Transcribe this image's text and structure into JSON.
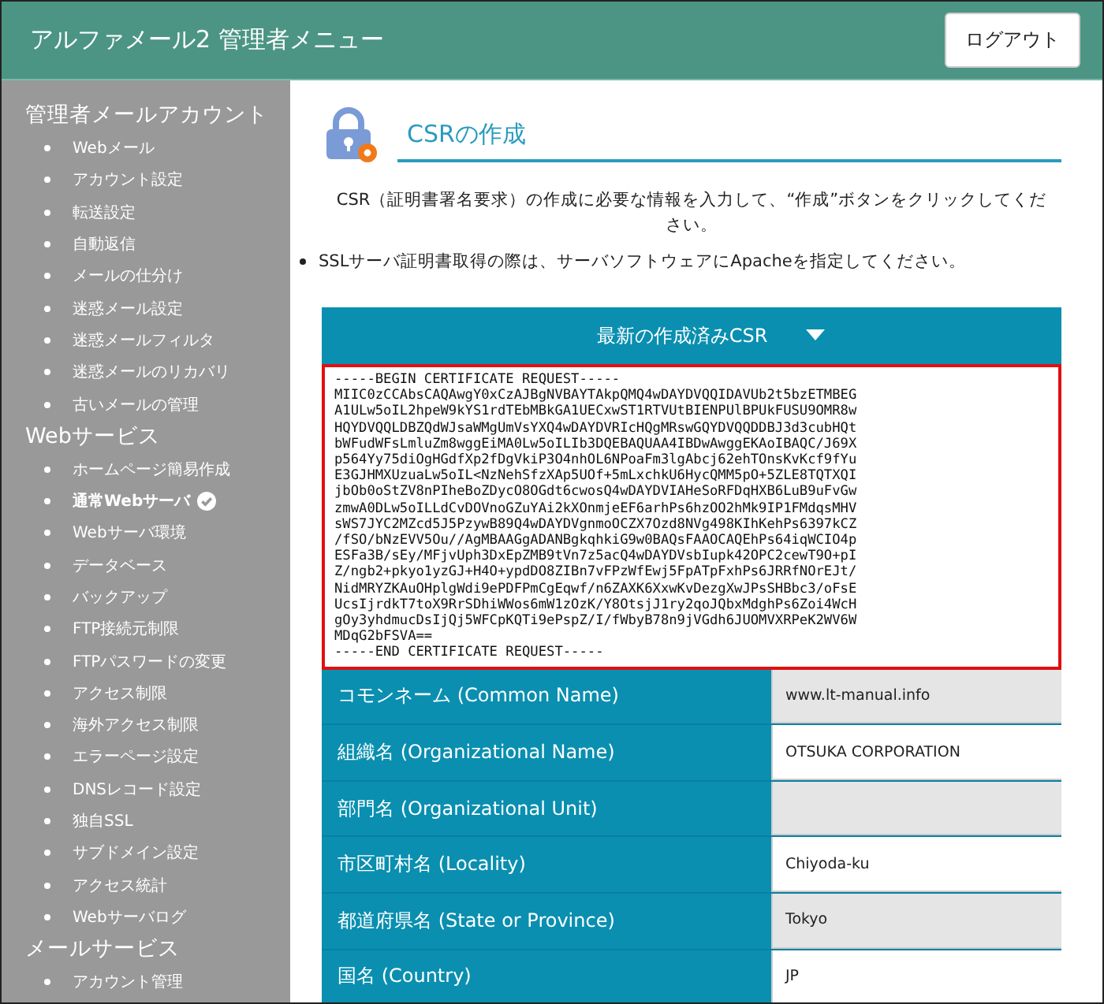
{
  "header": {
    "title": "アルファメール2 管理者メニュー",
    "logout_button": "ログアウト"
  },
  "sidebar": {
    "sections": [
      {
        "title": "管理者メールアカウント",
        "items": [
          {
            "label": "Webメール",
            "selected": false
          },
          {
            "label": "アカウント設定",
            "selected": false
          },
          {
            "label": "転送設定",
            "selected": false
          },
          {
            "label": "自動返信",
            "selected": false
          },
          {
            "label": "メールの仕分け",
            "selected": false
          },
          {
            "label": "迷惑メール設定",
            "selected": false
          },
          {
            "label": "迷惑メールフィルタ",
            "selected": false
          },
          {
            "label": "迷惑メールのリカバリ",
            "selected": false
          },
          {
            "label": "古いメールの管理",
            "selected": false
          }
        ]
      },
      {
        "title": "Webサービス",
        "items": [
          {
            "label": "ホームページ簡易作成",
            "selected": false
          },
          {
            "label": "通常Webサーバ",
            "selected": true
          },
          {
            "label": "Webサーバ環境",
            "selected": false
          },
          {
            "label": "データベース",
            "selected": false
          },
          {
            "label": "バックアップ",
            "selected": false
          },
          {
            "label": "FTP接続元制限",
            "selected": false
          },
          {
            "label": "FTPパスワードの変更",
            "selected": false
          },
          {
            "label": "アクセス制限",
            "selected": false
          },
          {
            "label": "海外アクセス制限",
            "selected": false
          },
          {
            "label": "エラーページ設定",
            "selected": false
          },
          {
            "label": "DNSレコード設定",
            "selected": false
          },
          {
            "label": "独自SSL",
            "selected": false
          },
          {
            "label": "サブドメイン設定",
            "selected": false
          },
          {
            "label": "アクセス統計",
            "selected": false
          },
          {
            "label": "Webサーバログ",
            "selected": false
          }
        ]
      },
      {
        "title": "メールサービス",
        "items": [
          {
            "label": "アカウント管理",
            "selected": false
          }
        ]
      }
    ]
  },
  "page": {
    "title": "CSRの作成",
    "description": "CSR（証明書署名要求）の作成に必要な情報を入力して、“作成”ボタンをクリックしてください。",
    "notes": [
      "SSLサーバ証明書取得の際は、サーバソフトウェアにApacheを指定してください。"
    ],
    "csr_panel": {
      "title": "最新の作成済みCSR",
      "expanded": true,
      "lines": [
        "-----BEGIN CERTIFICATE REQUEST-----",
        "MIIC0zCCAbsCAQAwgY0xCzAJBgNVBAYTAkpQMQ4wDAYDVQQIDAVUb2t5bzETMBEG",
        "A1ULw5oIL2hpeW9kYS1rdTEbMBkGA1UECxwST1RTVUtBIENPUlBPUkFUSU9OMR8w",
        "HQYDVQQLDBZQdWJsaWMgUmVsYXQ4wDAYDVRIcHQgMRswGQYDVQQDDBJ3d3cubHQt",
        "bWFudWFsLmluZm8wggEiMA0Lw5oILIb3DQEBAQUAA4IBDwAwggEKAoIBAQC/J69X",
        "p564Yy75diOgHGdfXp2fDgVkiP3O4nhOL6NPoaFm3lgAbcj62ehTOnsKvKcf9fYu",
        "E3GJHMXUzuaLw5oIL<NzNehSfzXAp5UOf+5mLxchkU6HycQMM5pO+5ZLE8TQTXQI",
        "jbOb0oStZV8nPIheBoZDycO8OGdt6cwosQ4wDAYDVIAHeSoRFDqHXB6LuB9uFvGw",
        "zmwA0DLw5oILLdCvDOVnoGZuYAi2kXOnmjeEF6arhPs6hzOO2hMk9IP1FMdqsMHV",
        "sWS7JYC2MZcd5J5PzywB89Q4wDAYDVgnmoOCZX7Ozd8NVg498KIhKehPs6397kCZ",
        "/fSO/bNzEVV5Ou//AgMBAAGgADANBgkqhkiG9w0BAQsFAAOCAQEhPs64iqWCIO4p",
        "ESFa3B/sEy/MFjvUph3DxEpZMB9tVn7z5acQ4wDAYDVsbIupk42OPC2cewT9O+pI",
        "Z/ngb2+pkyo1yzGJ+H4O+ypdDO8ZIBn7vFPzWfEwj5FpATpFxhPs6JRRfNOrEJt/",
        "NidMRYZKAuOHplgWdi9ePDFPmCgEqwf/n6ZAXK6XxwKvDezgXwJPsSHBbc3/oFsE",
        "UcsIjrdkT7toX9RrSDhiWWos6mW1zOzK/Y8OtsjJ1ry2qoJQbxMdghPs6Zoi4WcH",
        "gOy3yhdmucDsIjQj5WFCpKQTi9ePspZ/I/fWbyB78n9jVGdh6JUOMVXRPeK2WV6W",
        "MDqG2bFSVA==",
        "-----END CERTIFICATE REQUEST-----"
      ]
    },
    "fields": [
      {
        "label": "コモンネーム (Common Name)",
        "value": "www.lt-manual.info"
      },
      {
        "label": "組織名 (Organizational Name)",
        "value": "OTSUKA CORPORATION"
      },
      {
        "label": "部門名 (Organizational Unit)"
      },
      {
        "label": "市区町村名 (Locality)",
        "value": "Chiyoda-ku"
      },
      {
        "label": "都道府県名 (State or Province)",
        "value": "Tokyo"
      },
      {
        "label": "国名 (Country)",
        "value": "JP"
      }
    ]
  }
}
